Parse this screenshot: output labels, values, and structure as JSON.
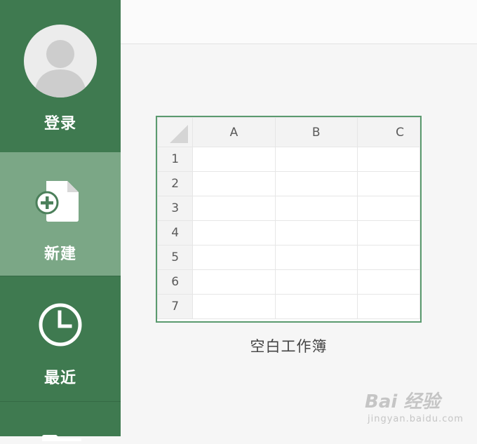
{
  "sidebar": {
    "login_label": "登录",
    "new_label": "新建",
    "recent_label": "最近"
  },
  "icons": {
    "avatar": "user-avatar-icon",
    "new": "new-document-plus-icon",
    "recent": "clock-icon",
    "open": "folder-icon"
  },
  "colors": {
    "sidebar": "#3f7a50",
    "sidebar_selected": "#7ba786",
    "template_border": "#5a9a6e"
  },
  "template": {
    "columns": [
      "A",
      "B",
      "C"
    ],
    "rows": [
      "1",
      "2",
      "3",
      "4",
      "5",
      "6",
      "7"
    ],
    "caption": "空白工作簿"
  },
  "watermark": {
    "main": "Bai 经验",
    "sub": "jingyan.baidu.com"
  }
}
